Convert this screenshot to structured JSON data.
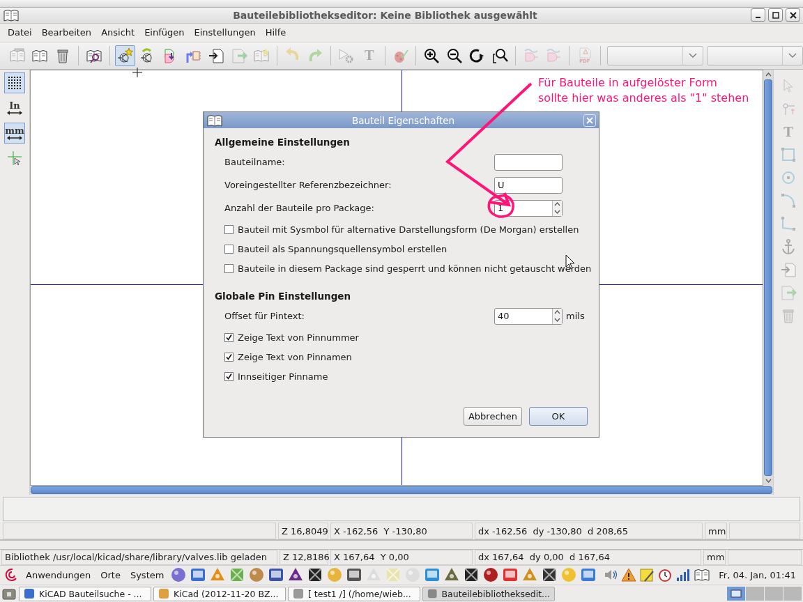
{
  "window": {
    "title": "Bauteilebibliothekseditor: Keine Bibliothek ausgewählt"
  },
  "menu": [
    "Datei",
    "Bearbeiten",
    "Ansicht",
    "Einfügen",
    "Einstellungen",
    "Hilfe"
  ],
  "toolbar": [
    {
      "kind": "button",
      "disabled": true,
      "selected": false
    },
    {
      "kind": "button",
      "disabled": false,
      "selected": false
    },
    {
      "kind": "button",
      "disabled": false,
      "selected": false
    },
    {
      "kind": "separator"
    },
    {
      "kind": "button",
      "disabled": false,
      "selected": false
    },
    {
      "kind": "separator"
    },
    {
      "kind": "button",
      "disabled": false,
      "selected": true
    },
    {
      "kind": "button",
      "disabled": false,
      "selected": false
    },
    {
      "kind": "button",
      "disabled": false,
      "selected": false
    },
    {
      "kind": "button",
      "disabled": false,
      "selected": false
    },
    {
      "kind": "button",
      "disabled": false,
      "selected": false
    },
    {
      "kind": "button",
      "disabled": true,
      "selected": false
    },
    {
      "kind": "button",
      "disabled": true,
      "selected": false
    },
    {
      "kind": "separator"
    },
    {
      "kind": "button",
      "disabled": true,
      "selected": false
    },
    {
      "kind": "button",
      "disabled": true,
      "selected": false
    },
    {
      "kind": "separator"
    },
    {
      "kind": "button",
      "disabled": true,
      "selected": false
    },
    {
      "kind": "button",
      "label": "T",
      "disabled": true,
      "selected": false
    },
    {
      "kind": "separator"
    },
    {
      "kind": "button",
      "disabled": true,
      "selected": false
    },
    {
      "kind": "separator"
    },
    {
      "kind": "button",
      "disabled": false,
      "selected": false
    },
    {
      "kind": "button",
      "disabled": false,
      "selected": false
    },
    {
      "kind": "button",
      "disabled": false,
      "selected": false
    },
    {
      "kind": "button",
      "disabled": false,
      "selected": false
    },
    {
      "kind": "separator"
    },
    {
      "kind": "button",
      "disabled": true,
      "selected": false
    },
    {
      "kind": "button",
      "disabled": true,
      "selected": false
    },
    {
      "kind": "separator"
    },
    {
      "kind": "button",
      "label": "PDF",
      "disabled": true,
      "selected": false
    },
    {
      "kind": "separator"
    },
    {
      "kind": "combo"
    },
    {
      "kind": "combo"
    }
  ],
  "left_toolbar": [
    {
      "selected": true
    },
    {
      "label": "In",
      "selected": false
    },
    {
      "label": "mm",
      "selected": true
    },
    {
      "selected": false
    }
  ],
  "right_toolbar": [
    {
      "disabled": true
    },
    {
      "disabled": true
    },
    {
      "label": "T",
      "disabled": true
    },
    {
      "disabled": true
    },
    {
      "disabled": true
    },
    {
      "disabled": true
    },
    {
      "disabled": true
    },
    {
      "disabled": true
    },
    {
      "disabled": true
    },
    {
      "disabled": true
    },
    {
      "disabled": true
    }
  ],
  "dialog": {
    "title": "Bauteil Eigenschaften",
    "sections": [
      {
        "heading": "Allgemeine Einstellungen",
        "rows": [
          {
            "kind": "field",
            "label": "Bauteilname:"
          },
          {
            "kind": "field",
            "label": "Voreingestellter Referenzbezeichner:",
            "value": "U"
          },
          {
            "kind": "spin",
            "label": "Anzahl der Bauteile pro Package:",
            "value": "1"
          },
          {
            "kind": "checkbox",
            "label": "Bauteil mit Sysmbol für alternative Darstellungsform (De Morgan) erstellen",
            "checked": false
          },
          {
            "kind": "checkbox",
            "label": "Bauteil als Spannungsquellensymbol erstellen",
            "checked": false
          },
          {
            "kind": "checkbox",
            "label": "Bauteile in diesem Package sind gesperrt und können nicht getauscht werden",
            "checked": false
          }
        ]
      },
      {
        "heading": "Globale Pin Einstellungen",
        "rows": [
          {
            "kind": "spin",
            "label": "Offset für Pintext:",
            "value": "40",
            "unit": "mils"
          },
          {
            "kind": "checkbox",
            "label": "Zeige Text von Pinnummer",
            "checked": true
          },
          {
            "kind": "checkbox",
            "label": "Zeige Text von Pinnamen",
            "checked": true
          },
          {
            "kind": "checkbox",
            "label": "Innseitiger Pinname",
            "checked": true
          }
        ]
      }
    ],
    "buttons": [
      {
        "label": "Abbrechen",
        "default": false
      },
      {
        "label": "OK",
        "default": true
      }
    ]
  },
  "annotation": {
    "text": "Für Bauteile in aufgelöster Form\nsollte hier was anderes als \"1\" stehen"
  },
  "status_bar": {
    "cells": [
      "Z 16,8049",
      "X -162,56  Y -130,80",
      "dx -162,56  dy -130,80  d 208,65",
      "mm"
    ]
  },
  "library_status_bar": {
    "message": "Bibliothek /usr/local/kicad/share/library/valves.lib geladen",
    "cells": [
      "Z 12,8186",
      "X 167,64  Y 0,00",
      "dx 167,64  dy 0,00  d 167,64",
      "mm"
    ]
  },
  "panel": {
    "menus": [
      "Anwendungen",
      "Orte",
      "System"
    ],
    "clock": "Fr, 04. Jan, 01:41"
  },
  "taskbar": {
    "tasks": [
      {
        "label": "KiCAD Bauteilsuche - ...",
        "selected": false
      },
      {
        "label": "KiCad (2012-11-20 BZ...",
        "selected": false
      },
      {
        "label": "[ test1 /] (/home/wieb...",
        "selected": false
      },
      {
        "label": "Bauteilebibliotheksedit...",
        "selected": true
      }
    ],
    "workspaces": [
      {
        "selected": true
      },
      {
        "selected": false
      },
      {
        "selected": false
      },
      {
        "selected": false
      }
    ]
  }
}
